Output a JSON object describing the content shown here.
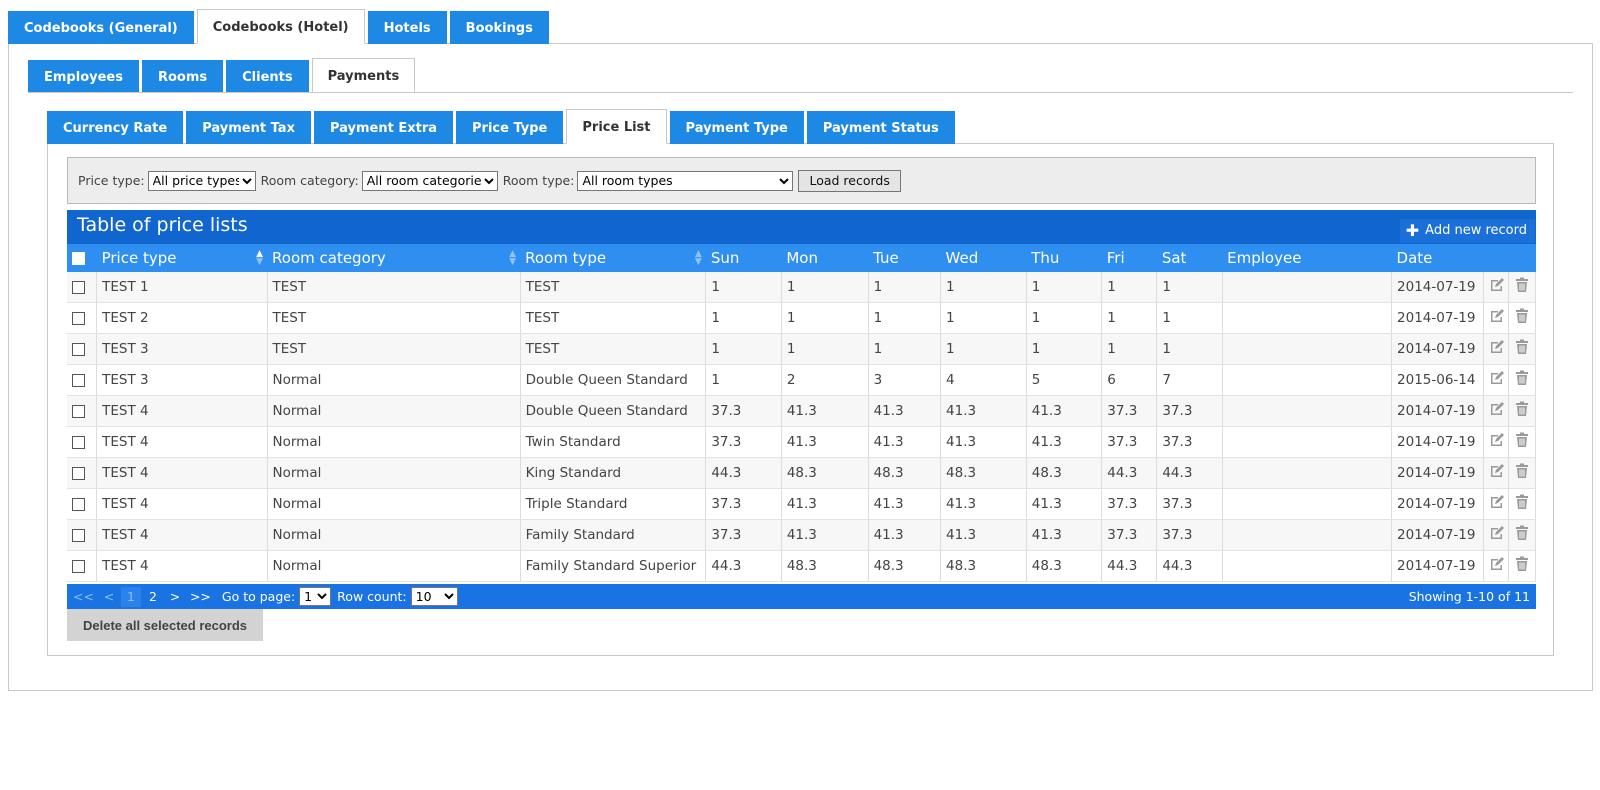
{
  "tabs_level1": [
    {
      "label": "Codebooks (General)",
      "active": false
    },
    {
      "label": "Codebooks (Hotel)",
      "active": true
    },
    {
      "label": "Hotels",
      "active": false
    },
    {
      "label": "Bookings",
      "active": false
    }
  ],
  "tabs_level2": [
    {
      "label": "Employees",
      "active": false
    },
    {
      "label": "Rooms",
      "active": false
    },
    {
      "label": "Clients",
      "active": false
    },
    {
      "label": "Payments",
      "active": true
    }
  ],
  "tabs_level3": [
    {
      "label": "Currency Rate",
      "active": false
    },
    {
      "label": "Payment Tax",
      "active": false
    },
    {
      "label": "Payment Extra",
      "active": false
    },
    {
      "label": "Price Type",
      "active": false
    },
    {
      "label": "Price List",
      "active": true
    },
    {
      "label": "Payment Type",
      "active": false
    },
    {
      "label": "Payment Status",
      "active": false
    }
  ],
  "filters": {
    "price_type_label": "Price type:",
    "price_type_value": "All price types",
    "room_category_label": "Room category:",
    "room_category_value": "All room categories",
    "room_type_label": "Room type:",
    "room_type_value": "All room types",
    "load_button": "Load records"
  },
  "table": {
    "title": "Table of price lists",
    "add_button": "Add new record",
    "columns": [
      "Price type",
      "Room category",
      "Room type",
      "Sun",
      "Mon",
      "Tue",
      "Wed",
      "Thu",
      "Fri",
      "Sat",
      "Employee",
      "Date"
    ],
    "rows": [
      [
        "TEST 1",
        "TEST",
        "TEST",
        "1",
        "1",
        "1",
        "1",
        "1",
        "1",
        "1",
        "",
        "2014-07-19"
      ],
      [
        "TEST 2",
        "TEST",
        "TEST",
        "1",
        "1",
        "1",
        "1",
        "1",
        "1",
        "1",
        "",
        "2014-07-19"
      ],
      [
        "TEST 3",
        "TEST",
        "TEST",
        "1",
        "1",
        "1",
        "1",
        "1",
        "1",
        "1",
        "",
        "2014-07-19"
      ],
      [
        "TEST 3",
        "Normal",
        "Double Queen Standard",
        "1",
        "2",
        "3",
        "4",
        "5",
        "6",
        "7",
        "",
        "2015-06-14"
      ],
      [
        "TEST 4",
        "Normal",
        "Double Queen Standard",
        "37.3",
        "41.3",
        "41.3",
        "41.3",
        "41.3",
        "37.3",
        "37.3",
        "",
        "2014-07-19"
      ],
      [
        "TEST 4",
        "Normal",
        "Twin Standard",
        "37.3",
        "41.3",
        "41.3",
        "41.3",
        "41.3",
        "37.3",
        "37.3",
        "",
        "2014-07-19"
      ],
      [
        "TEST 4",
        "Normal",
        "King Standard",
        "44.3",
        "48.3",
        "48.3",
        "48.3",
        "48.3",
        "44.3",
        "44.3",
        "",
        "2014-07-19"
      ],
      [
        "TEST 4",
        "Normal",
        "Triple Standard",
        "37.3",
        "41.3",
        "41.3",
        "41.3",
        "41.3",
        "37.3",
        "37.3",
        "",
        "2014-07-19"
      ],
      [
        "TEST 4",
        "Normal",
        "Family Standard",
        "37.3",
        "41.3",
        "41.3",
        "41.3",
        "41.3",
        "37.3",
        "37.3",
        "",
        "2014-07-19"
      ],
      [
        "TEST 4",
        "Normal",
        "Family Standard Superior",
        "44.3",
        "48.3",
        "48.3",
        "48.3",
        "48.3",
        "44.3",
        "44.3",
        "",
        "2014-07-19"
      ]
    ]
  },
  "pager": {
    "first": "<<",
    "prev": "<",
    "pages": [
      "1",
      "2"
    ],
    "current_page": "1",
    "next": ">",
    "last": ">>",
    "goto_label": "Go to page:",
    "goto_value": "1",
    "rowcount_label": "Row count:",
    "rowcount_value": "10",
    "showing": "Showing 1-10 of 11"
  },
  "delete_button": "Delete all selected records",
  "colors": {
    "tab_blue": "#1e88e5",
    "title_blue": "#1165cf",
    "header_blue": "#2e8ff0",
    "pager_blue": "#1a73e3"
  }
}
